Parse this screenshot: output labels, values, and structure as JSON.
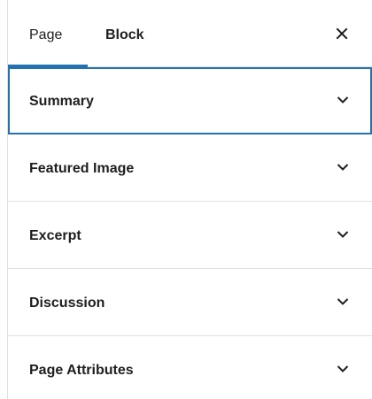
{
  "tabs": {
    "page_label": "Page",
    "block_label": "Block",
    "active": "page"
  },
  "close_icon": "close-icon",
  "panels": [
    {
      "label": "Summary",
      "expanded": false,
      "focused": true,
      "icon": "chevron-down-icon"
    },
    {
      "label": "Featured Image",
      "expanded": false,
      "focused": false,
      "icon": "chevron-down-icon"
    },
    {
      "label": "Excerpt",
      "expanded": false,
      "focused": false,
      "icon": "chevron-down-icon"
    },
    {
      "label": "Discussion",
      "expanded": false,
      "focused": false,
      "icon": "chevron-down-icon"
    },
    {
      "label": "Page Attributes",
      "expanded": false,
      "focused": false,
      "icon": "chevron-down-icon"
    }
  ],
  "colors": {
    "accent": "#2271b1",
    "divider": "#e0e0e0",
    "text": "#1e1e1e"
  }
}
